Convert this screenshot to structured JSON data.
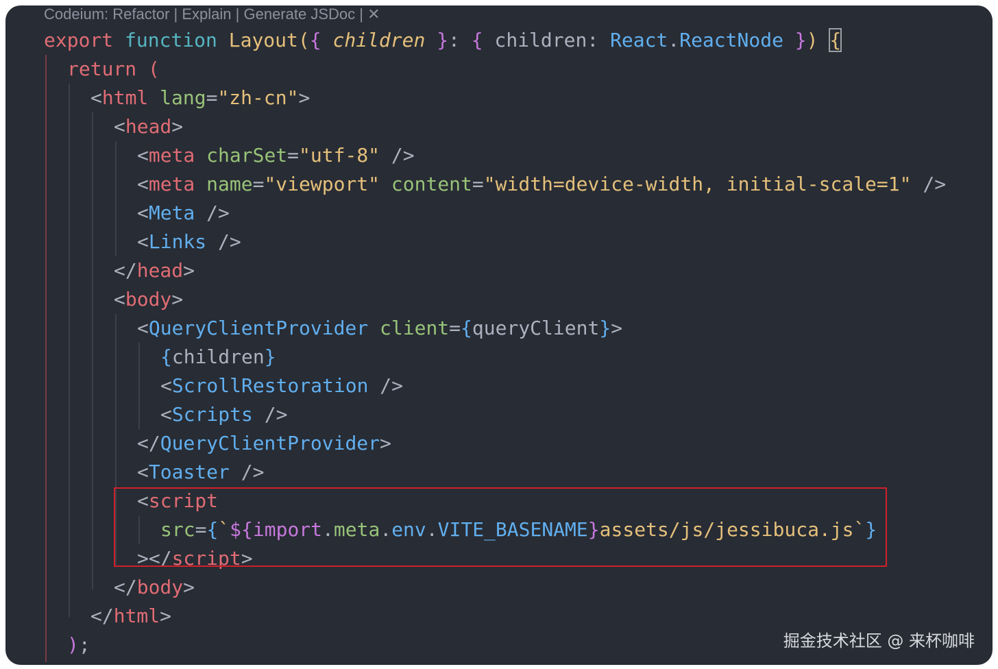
{
  "codelens": {
    "refactor": "Codeium: Refactor",
    "sep1": " | ",
    "explain": "Explain",
    "sep2": " | ",
    "jsdoc": "Generate JSDoc",
    "sep3": " | ",
    "close": "✕"
  },
  "code": {
    "l1": [
      "export",
      " ",
      "function",
      " ",
      "Layout",
      "(",
      "{",
      " ",
      "children",
      " ",
      "}",
      ": ",
      "{",
      " children: ",
      "React",
      ".",
      "ReactNode",
      " ",
      "}",
      ")",
      " ",
      "{"
    ],
    "l2": [
      "return",
      " ",
      "("
    ],
    "l3": [
      "<",
      "html",
      " ",
      "lang",
      "=",
      "\"zh-cn\"",
      ">"
    ],
    "l4": [
      "<",
      "head",
      ">"
    ],
    "l5": [
      "<",
      "meta",
      " ",
      "charSet",
      "=",
      "\"utf-8\"",
      " />"
    ],
    "l6": [
      "<",
      "meta",
      " ",
      "name",
      "=",
      "\"viewport\"",
      " ",
      "content",
      "=",
      "\"width=device-width, initial-scale=1\"",
      " />"
    ],
    "l7": [
      "<",
      "Meta",
      " />"
    ],
    "l8": [
      "<",
      "Links",
      " />"
    ],
    "l9": [
      "</",
      "head",
      ">"
    ],
    "l10": [
      "<",
      "body",
      ">"
    ],
    "l11": [
      "<",
      "QueryClientProvider",
      " ",
      "client",
      "=",
      "{",
      "queryClient",
      "}",
      ">"
    ],
    "l12": [
      "{",
      "children",
      "}"
    ],
    "l13": [
      "<",
      "ScrollRestoration",
      " />"
    ],
    "l14": [
      "<",
      "Scripts",
      " />"
    ],
    "l15": [
      "</",
      "QueryClientProvider",
      ">"
    ],
    "l16": [
      "<",
      "Toaster",
      " />"
    ],
    "l17": [
      "<",
      "script"
    ],
    "l18": [
      "src",
      "=",
      "{",
      "`",
      "${",
      "import",
      ".",
      "meta",
      ".",
      "env",
      ".",
      "VITE_BASENAME",
      "}",
      "assets/js/jessibuca.js",
      "`",
      "}"
    ],
    "l19": [
      ">",
      "</",
      "script",
      ">"
    ],
    "l20": [
      "</",
      "body",
      ">"
    ],
    "l21": [
      "</",
      "html",
      ">"
    ],
    "l22": [
      ")",
      ";"
    ]
  },
  "watermark": "掘金技术社区 @ 来杯咖啡",
  "colors": {
    "background": "#282c34",
    "highlight_border": "#d0202a"
  }
}
